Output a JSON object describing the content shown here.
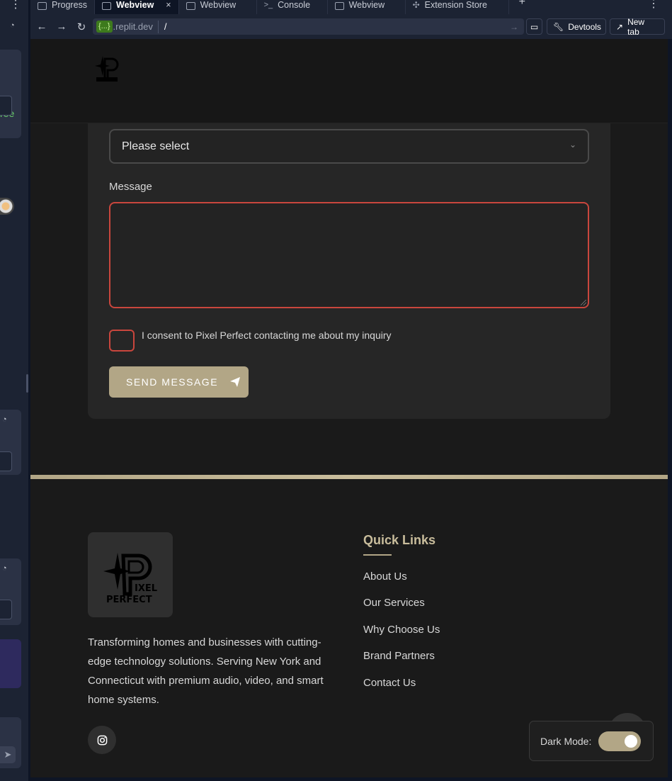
{
  "tabs": [
    {
      "label": "Progress",
      "active": false
    },
    {
      "label": "Webview",
      "active": true
    },
    {
      "label": "Webview",
      "active": false
    },
    {
      "label": "Console",
      "active": false
    },
    {
      "label": "Webview",
      "active": false
    },
    {
      "label": "Extension Store",
      "active": false
    }
  ],
  "tab_close": "×",
  "new_tab_glyph": "+",
  "address_bar": {
    "chip": "{...}",
    "domain": ".replit.dev",
    "path": "/",
    "devtools_label": "Devtools",
    "new_tab_label": "New tab"
  },
  "left_panel": {
    "snippet_text": "ree"
  },
  "form": {
    "select_value": "Please select",
    "message_label": "Message",
    "consent_text": "I consent to Pixel Perfect contacting me about my inquiry",
    "send_label": "SEND MESSAGE"
  },
  "footer": {
    "logo_text_1": "IXEL",
    "logo_text_2": "PERFECT",
    "description": "Transforming homes and businesses with cutting-edge technology solutions. Serving New York and Connecticut with premium audio, video, and smart home systems.",
    "quick_links_title": "Quick Links",
    "quick_links": [
      "About Us",
      "Our Services",
      "Why Choose Us",
      "Brand Partners",
      "Contact Us"
    ]
  },
  "dark_mode": {
    "label": "Dark Mode:",
    "enabled": true
  },
  "colors": {
    "accent": "#b2a686",
    "error": "#c9463d",
    "background": "#1a1a1a"
  }
}
